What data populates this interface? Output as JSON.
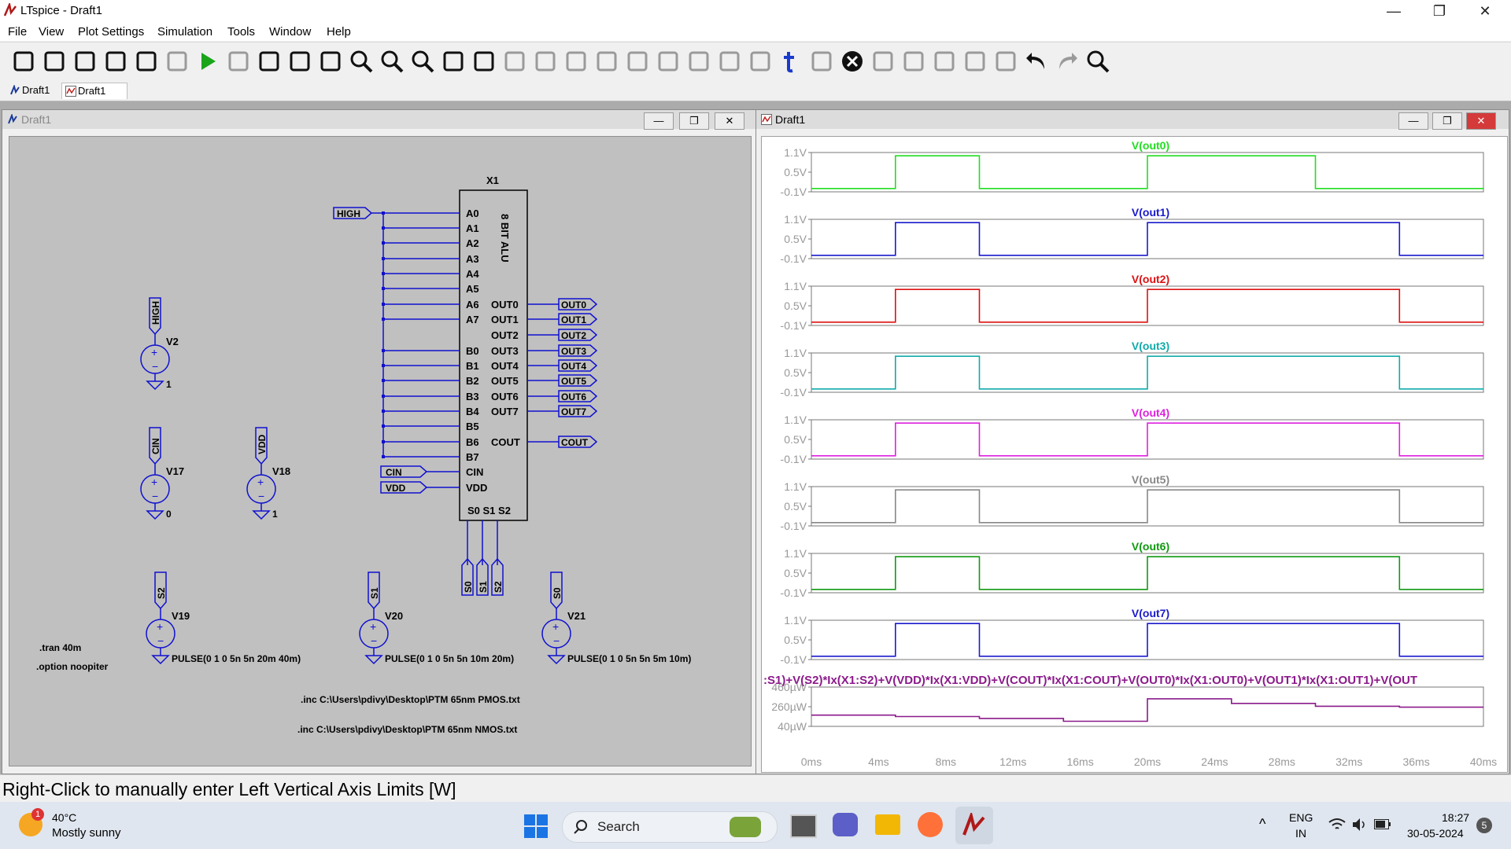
{
  "window": {
    "title": "LTspice - Draft1",
    "controls": {
      "minimize": "—",
      "restore": "❐",
      "close": "✕"
    }
  },
  "menu": [
    "File",
    "View",
    "Plot Settings",
    "Simulation",
    "Tools",
    "Window",
    "Help"
  ],
  "toolbar": {
    "icons": [
      "settings-icon",
      "new-schematic-icon",
      "open-icon",
      "save-icon",
      "print-icon",
      "halt-icon",
      "run-icon",
      "stop-icon",
      "tile-vertical-icon",
      "tile-horizontal-icon",
      "cascade-icon",
      "zoom-in-icon",
      "zoom-out-icon",
      "zoom-fit-icon",
      "autorange-icon",
      "add-trace-icon",
      "wire-icon",
      "ground-icon",
      "label-icon",
      "resistor-icon",
      "capacitor-icon",
      "inductor-icon",
      "diode-icon",
      "component-icon",
      "spice-directive-icon",
      "text-icon",
      "move-icon",
      "delete-icon",
      "duplicate-icon",
      "drag-icon",
      "rotate-icon",
      "mirror-icon",
      "rotate-flip-icon",
      "undo-icon",
      "redo-icon",
      "find-icon"
    ]
  },
  "tabs": [
    {
      "label": "Draft1",
      "kind": "schematic"
    },
    {
      "label": "Draft1",
      "kind": "waveform"
    }
  ],
  "schematic": {
    "title": "Draft1",
    "component": {
      "ref": "X1",
      "name": "8 BIT ALU",
      "left_pins": [
        "A0",
        "A1",
        "A2",
        "A3",
        "A4",
        "A5",
        "A6",
        "A7",
        "B0",
        "B1",
        "B2",
        "B3",
        "B4",
        "B5",
        "B6",
        "B7",
        "CIN",
        "VDD"
      ],
      "right_pins": [
        "OUT0",
        "OUT1",
        "OUT2",
        "OUT3",
        "OUT4",
        "OUT5",
        "OUT6",
        "OUT7",
        "COUT"
      ],
      "bottom_pins": "S0 S1 S2"
    },
    "net_labels": {
      "high": "HIGH",
      "cin": "CIN",
      "vdd": "VDD",
      "outs": [
        "OUT0",
        "OUT1",
        "OUT2",
        "OUT3",
        "OUT4",
        "OUT5",
        "OUT6",
        "OUT7"
      ],
      "cout": "COUT",
      "s0": "S0",
      "s1": "S1",
      "s2": "S2"
    },
    "sources": [
      {
        "ref": "V2",
        "net": "HIGH",
        "value": "1"
      },
      {
        "ref": "V17",
        "net": "CIN",
        "value": "0"
      },
      {
        "ref": "V18",
        "net": "VDD",
        "value": "1"
      },
      {
        "ref": "V19",
        "net": "S2",
        "value": "PULSE(0 1 0 5n 5n 20m 40m)"
      },
      {
        "ref": "V20",
        "net": "S1",
        "value": "PULSE(0 1 0 5n 5n 10m 20m)"
      },
      {
        "ref": "V21",
        "net": "S0",
        "value": "PULSE(0 1 0 5n 5n 5m 10m)"
      }
    ],
    "directives": [
      ".tran 40m",
      ".option noopiter",
      ".inc C:\\Users\\pdivy\\Desktop\\PTM 65nm PMOS.txt",
      ".inc C:\\Users\\pdivy\\Desktop\\PTM 65nm NMOS.txt"
    ]
  },
  "chart_data": [
    {
      "type": "line",
      "title": "V(out0)",
      "color": "#22dd22",
      "yticks": [
        "1.1V",
        "0.5V",
        "-0.1V"
      ],
      "ylim": [
        -0.1,
        1.1
      ],
      "xlim": [
        0,
        40
      ],
      "x": [
        0,
        5,
        5,
        10,
        10,
        20,
        20,
        30,
        30,
        40
      ],
      "y": [
        0,
        0,
        1,
        1,
        0,
        0,
        1,
        1,
        0,
        0
      ]
    },
    {
      "type": "line",
      "title": "V(out1)",
      "color": "#1a1acc",
      "yticks": [
        "1.1V",
        "0.5V",
        "-0.1V"
      ],
      "ylim": [
        -0.1,
        1.1
      ],
      "xlim": [
        0,
        40
      ],
      "x": [
        0,
        5,
        5,
        10,
        10,
        20,
        20,
        35,
        35,
        40
      ],
      "y": [
        0,
        0,
        1,
        1,
        0,
        0,
        1,
        1,
        0,
        0
      ]
    },
    {
      "type": "line",
      "title": "V(out2)",
      "color": "#dd1111",
      "yticks": [
        "1.1V",
        "0.5V",
        "-0.1V"
      ],
      "ylim": [
        -0.1,
        1.1
      ],
      "xlim": [
        0,
        40
      ],
      "x": [
        0,
        5,
        5,
        10,
        10,
        20,
        20,
        35,
        35,
        40
      ],
      "y": [
        0,
        0,
        1,
        1,
        0,
        0,
        1,
        1,
        0,
        0
      ]
    },
    {
      "type": "line",
      "title": "V(out3)",
      "color": "#11aaaa",
      "yticks": [
        "1.1V",
        "0.5V",
        "-0.1V"
      ],
      "ylim": [
        -0.1,
        1.1
      ],
      "xlim": [
        0,
        40
      ],
      "x": [
        0,
        5,
        5,
        10,
        10,
        20,
        20,
        35,
        35,
        40
      ],
      "y": [
        0,
        0,
        1,
        1,
        0,
        0,
        1,
        1,
        0,
        0
      ]
    },
    {
      "type": "line",
      "title": "V(out4)",
      "color": "#dd22dd",
      "yticks": [
        "1.1V",
        "0.5V",
        "-0.1V"
      ],
      "ylim": [
        -0.1,
        1.1
      ],
      "xlim": [
        0,
        40
      ],
      "x": [
        0,
        5,
        5,
        10,
        10,
        20,
        20,
        35,
        35,
        40
      ],
      "y": [
        0,
        0,
        1,
        1,
        0,
        0,
        1,
        1,
        0,
        0
      ]
    },
    {
      "type": "line",
      "title": "V(out5)",
      "color": "#888888",
      "yticks": [
        "1.1V",
        "0.5V",
        "-0.1V"
      ],
      "ylim": [
        -0.1,
        1.1
      ],
      "xlim": [
        0,
        40
      ],
      "x": [
        0,
        5,
        5,
        10,
        10,
        20,
        20,
        35,
        35,
        40
      ],
      "y": [
        0,
        0,
        1,
        1,
        0,
        0,
        1,
        1,
        0,
        0
      ]
    },
    {
      "type": "line",
      "title": "V(out6)",
      "color": "#119911",
      "yticks": [
        "1.1V",
        "0.5V",
        "-0.1V"
      ],
      "ylim": [
        -0.1,
        1.1
      ],
      "xlim": [
        0,
        40
      ],
      "x": [
        0,
        5,
        5,
        10,
        10,
        20,
        20,
        35,
        35,
        40
      ],
      "y": [
        0,
        0,
        1,
        1,
        0,
        0,
        1,
        1,
        0,
        0
      ]
    },
    {
      "type": "line",
      "title": "V(out7)",
      "color": "#1a1acc",
      "yticks": [
        "1.1V",
        "0.5V",
        "-0.1V"
      ],
      "ylim": [
        -0.1,
        1.1
      ],
      "xlim": [
        0,
        40
      ],
      "x": [
        0,
        5,
        5,
        10,
        10,
        20,
        20,
        35,
        35,
        40
      ],
      "y": [
        0,
        0,
        1,
        1,
        0,
        0,
        1,
        1,
        0,
        0
      ]
    },
    {
      "type": "line",
      "title": ":S1)+V(S2)*Ix(X1:S2)+V(VDD)*Ix(X1:VDD)+V(COUT)*Ix(X1:COUT)+V(OUT0)*Ix(X1:OUT0)+V(OUT1)*Ix(X1:OUT1)+V(OUT",
      "color": "#8b1a8b",
      "yticks": [
        "460µW",
        "260µW",
        "40µW"
      ],
      "ylim": [
        40,
        460
      ],
      "xlim": [
        0,
        40
      ],
      "x": [
        0,
        5,
        5,
        10,
        10,
        15,
        15,
        20,
        20,
        25,
        25,
        30,
        30,
        35,
        35,
        40
      ],
      "y": [
        160,
        160,
        145,
        145,
        125,
        125,
        95,
        95,
        335,
        335,
        285,
        285,
        255,
        255,
        245,
        245
      ]
    }
  ],
  "xaxis": {
    "ticks": [
      "0ms",
      "4ms",
      "8ms",
      "12ms",
      "16ms",
      "20ms",
      "24ms",
      "28ms",
      "32ms",
      "36ms",
      "40ms"
    ]
  },
  "status": "Right-Click to manually enter Left Vertical Axis Limits [W]",
  "taskbar": {
    "weather_temp": "40°C",
    "weather_desc": "Mostly sunny",
    "weather_badge": "1",
    "search": "Search",
    "lang": "ENG",
    "region": "IN",
    "time": "18:27",
    "date": "30-05-2024",
    "notif": "5"
  }
}
